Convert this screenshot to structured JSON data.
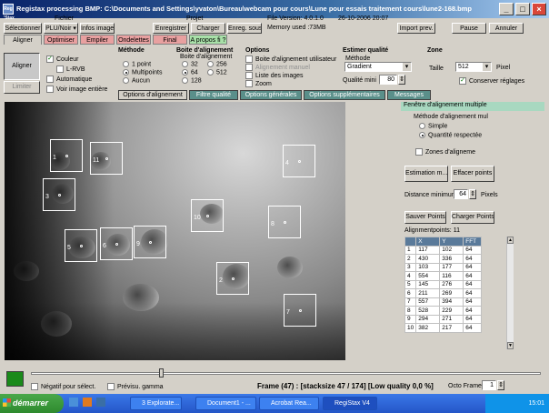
{
  "window": {
    "title": "Registax processing BMP: C:\\Documents and Settings\\yvaton\\Bureau\\webcam pour cours\\Lune pour essais traitement cours\\lune2-168.bmp",
    "app_icon": "Reg 'Stax"
  },
  "toolbar": {
    "fichier_label": "Fichier",
    "projet_label": "Projet",
    "select_button": "Sélectionner",
    "mode_select": "PLU/Noir",
    "info_button": "Infos image",
    "save_button": "Enregistrer",
    "load_button": "Charger",
    "save_as_button": "Enreg. sous",
    "file_version": "File Version: 4.0.1.0",
    "datetime": "26-10-2006 20:07",
    "memory": "Memory used :73MB",
    "import_button": "Import prev.",
    "pause_button": "Pause",
    "cancel_button": "Annuler"
  },
  "main_tabs": [
    "Aligner",
    "Optimiser",
    "Empiler",
    "Ondelettes",
    "Final",
    "A propos fi ?"
  ],
  "left_controls": {
    "align_button": "Aligner",
    "limit_button": "Limiter",
    "color_check": "Couleur",
    "lrvb_check": "L-RVB",
    "auto_check": "Automatique",
    "whole_image_check": "Voir image entière"
  },
  "methode": {
    "title": "Méthode",
    "options": [
      "1 point",
      "Multipoints",
      "Aucun"
    ],
    "selected": "Multipoints"
  },
  "boite": {
    "title": "Boite d'alignement",
    "subtitle": "Boite d'alignement",
    "options": [
      "32",
      "256",
      "64",
      "512",
      "128"
    ],
    "selected": "64"
  },
  "options_panel": {
    "title": "Options",
    "items": [
      "Boite d'alignement utilisateur",
      "Alignement manuel",
      "Liste des images",
      "Zoom"
    ]
  },
  "estimer": {
    "title": "Estimer qualité",
    "methode_label": "Méthode",
    "methode_value": "Gradient",
    "qualite_label": "Qualité mini",
    "qualite_value": "80"
  },
  "zone": {
    "title": "Zone",
    "taille_label": "Taille",
    "taille_value": "512",
    "unit": "Pixel",
    "conserver_check": "Conserver réglages"
  },
  "sub_tabs": [
    "Options d'alignement",
    "Filtre qualité",
    "Options générales",
    "Options supplémentaires",
    "Messages"
  ],
  "align_points_overlay": [
    {
      "num": "1"
    },
    {
      "num": "11"
    },
    {
      "num": "3"
    },
    {
      "num": "5"
    },
    {
      "num": "6"
    },
    {
      "num": "9"
    },
    {
      "num": "10"
    },
    {
      "num": "2"
    },
    {
      "num": "4"
    },
    {
      "num": "8"
    },
    {
      "num": "7"
    }
  ],
  "right_panel": {
    "window_title": "Fenêtre d'alignement multiple",
    "method_group": "Méthode d'alignement mul",
    "method_options": [
      "Simple",
      "Quantité respectée"
    ],
    "method_selected": "Quantité respectée",
    "zones_check": "Zones d'aligneme",
    "estimation_button": "Estimation m...",
    "erase_button": "Effacer points",
    "distance_label": "Distance minimum",
    "distance_value": "64",
    "distance_unit": "Pixels",
    "save_points_button": "Sauver Points",
    "load_points_button": "Charger Points",
    "points_count_label": "Alignmentpoints: 11",
    "table_headers": [
      "",
      "X",
      "Y",
      "FFT"
    ],
    "table_rows": [
      [
        "1",
        "117",
        "102",
        "64"
      ],
      [
        "2",
        "430",
        "336",
        "64"
      ],
      [
        "3",
        "103",
        "177",
        "64"
      ],
      [
        "4",
        "554",
        "116",
        "64"
      ],
      [
        "5",
        "145",
        "276",
        "64"
      ],
      [
        "6",
        "211",
        "269",
        "64"
      ],
      [
        "7",
        "557",
        "394",
        "64"
      ],
      [
        "8",
        "528",
        "229",
        "64"
      ],
      [
        "9",
        "294",
        "271",
        "64"
      ],
      [
        "10",
        "382",
        "217",
        "64"
      ]
    ]
  },
  "bottom": {
    "negatif_check": "Négatif pour sélect.",
    "previsu_check": "Prévisu. gamma",
    "frame_status": "Frame (47) : [stacksize 47 / 174] [Low quality 0,0 %]",
    "octo_label": "Octo Frame",
    "octo_value": "1"
  },
  "taskbar": {
    "start": "démarrer",
    "tasks": [
      "3 Explorate...",
      "Document1 - ...",
      "Acrobat Rea...",
      "RegiStax V4"
    ],
    "tray_time": "15:01"
  }
}
